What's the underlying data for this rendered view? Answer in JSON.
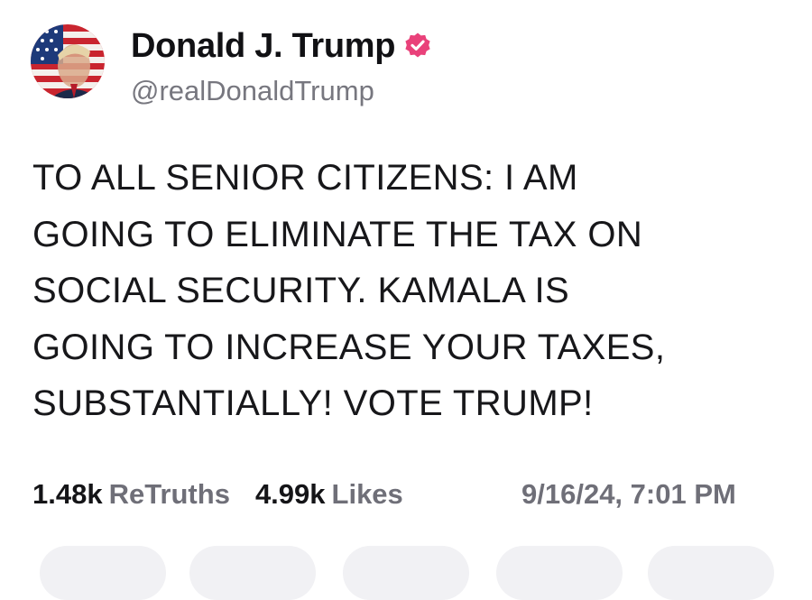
{
  "author": {
    "display_name": "Donald J. Trump",
    "handle": "@realDonaldTrump",
    "verified_color": "#e9417a"
  },
  "post": {
    "lines": [
      "TO ALL SENIOR CITIZENS: I AM",
      "GOING TO ELIMINATE THE TAX ON",
      "SOCIAL SECURITY. KAMALA IS",
      "GOING TO INCREASE YOUR TAXES,",
      "SUBSTANTIALLY! VOTE TRUMP!"
    ]
  },
  "stats": {
    "retruths_count": "1.48k",
    "retruths_label": "ReTruths",
    "likes_count": "4.99k",
    "likes_label": "Likes"
  },
  "timestamp": "9/16/24, 7:01 PM",
  "actions": [
    {
      "icon": "reply-icon"
    },
    {
      "icon": "retruth-icon"
    },
    {
      "icon": "like-icon"
    },
    {
      "icon": "share-icon"
    },
    {
      "icon": "more-icon"
    }
  ]
}
